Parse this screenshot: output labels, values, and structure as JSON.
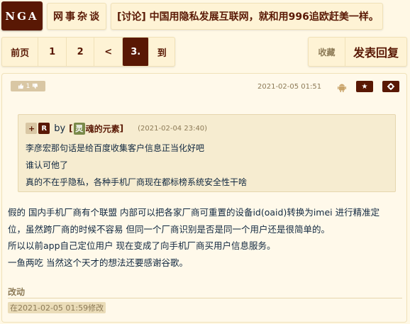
{
  "header": {
    "logo_text": "NGA",
    "forum_name": "网事杂谈",
    "topic_title": "[讨论] 中国用隐私发展互联网，就和用996追欧赶美一样。"
  },
  "pagination": {
    "first_label": "前页",
    "pages": [
      "1",
      "2",
      "<"
    ],
    "current": "3.",
    "goto_label": "到"
  },
  "actions": {
    "favorite_label": "收藏",
    "reply_label": "发表回复"
  },
  "post": {
    "like_count": "1",
    "timestamp": "2021-02-05 01:51",
    "quote": {
      "plus_label": "+",
      "reply_badge": "R",
      "by_label": "by",
      "user_prefix": "[",
      "user_avatar_char": "灵",
      "user_name": "魂的元素",
      "user_suffix": "]",
      "time": "(2021-02-04 23:40)",
      "lines": [
        "李彦宏那句话是给百度收集客户信息正当化好吧",
        "谁认可他了",
        "真的不在乎隐私，各种手机厂商现在都标榜系统安全性干啥"
      ]
    },
    "body_lines": [
      "假的 国内手机厂商有个联盟 内部可以把各家厂商可重置的设备id(oaid)转换为imei 进行精准定",
      "位，虽然跨厂商的时候不容易 但同一个厂商识别是否是同一个用户还是很简单的。",
      "所以以前app自己定位用户 现在变成了向手机厂商买用户信息服务。",
      "一鱼两吃 当然这个天才的想法还要感谢谷歌。"
    ],
    "change_label": "改动",
    "edit_note": "在2021-02-05 01:59修改"
  },
  "colors": {
    "background": "#fff8e5",
    "accent": "#591804",
    "muted": "#8c7a56",
    "text": "#10273f"
  }
}
